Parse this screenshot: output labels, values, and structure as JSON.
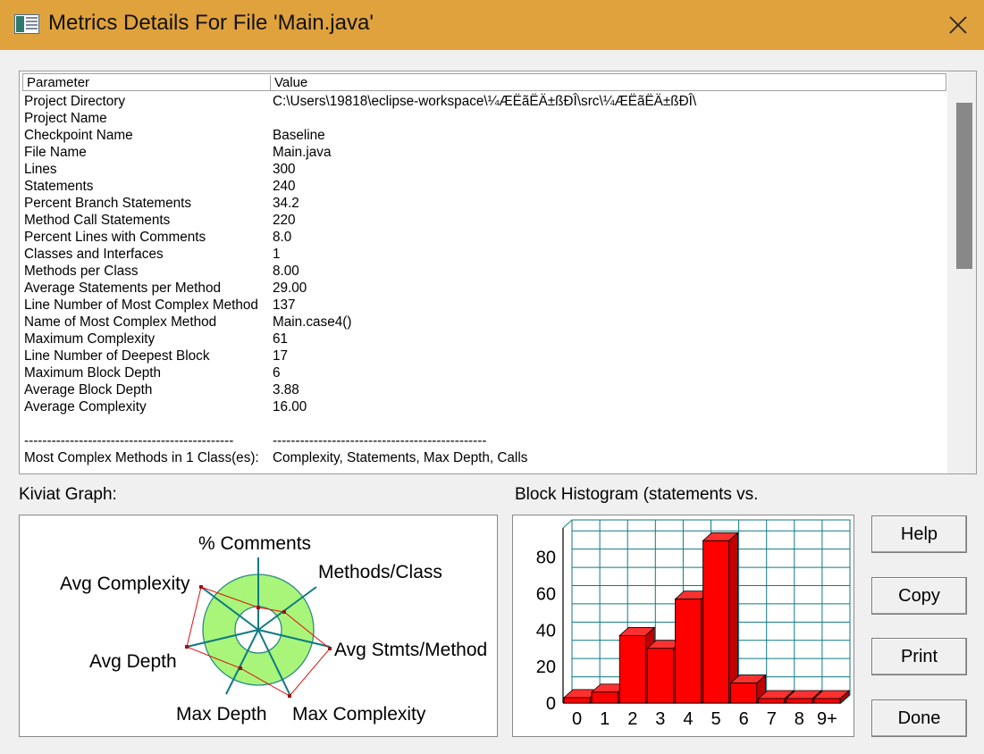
{
  "window": {
    "title": "Metrics Details For File 'Main.java'",
    "accent_color": "#e0a23c"
  },
  "table": {
    "headers": {
      "parameter": "Parameter",
      "value": "Value"
    },
    "rows": [
      {
        "p": "Project Directory",
        "v": "C:\\Users\\19818\\eclipse-workspace\\¼ÆËãËÄ±ßÐÎ\\src\\¼ÆËãËÄ±ßÐÎ\\"
      },
      {
        "p": "Project Name",
        "v": ""
      },
      {
        "p": "Checkpoint Name",
        "v": "Baseline"
      },
      {
        "p": "File Name",
        "v": "Main.java"
      },
      {
        "p": "Lines",
        "v": "300"
      },
      {
        "p": "Statements",
        "v": "240"
      },
      {
        "p": "Percent Branch Statements",
        "v": "34.2"
      },
      {
        "p": "Method Call Statements",
        "v": "220"
      },
      {
        "p": "Percent Lines with Comments",
        "v": "8.0"
      },
      {
        "p": "Classes and Interfaces",
        "v": "1"
      },
      {
        "p": "Methods per Class",
        "v": "8.00"
      },
      {
        "p": "Average Statements per Method",
        "v": "29.00"
      },
      {
        "p": "Line Number of Most Complex Method",
        "v": "137"
      },
      {
        "p": "Name of Most Complex Method",
        "v": "Main.case4()"
      },
      {
        "p": "Maximum Complexity",
        "v": "61"
      },
      {
        "p": "Line Number of Deepest Block",
        "v": "17"
      },
      {
        "p": "Maximum Block Depth",
        "v": "6"
      },
      {
        "p": "Average Block Depth",
        "v": "3.88"
      },
      {
        "p": "Average Complexity",
        "v": "16.00"
      },
      {
        "p": "",
        "v": ""
      },
      {
        "p": "----------------------------------------------",
        "v": "-----------------------------------------------"
      },
      {
        "p": "Most Complex Methods in 1 Class(es):",
        "v": "Complexity, Statements, Max Depth, Calls"
      }
    ]
  },
  "kiviat": {
    "label": "Kiviat Graph:",
    "axes": [
      "% Comments",
      "Methods/Class",
      "Avg Stmts/Method",
      "Max Complexity",
      "Max Depth",
      "Avg Depth",
      "Avg Complexity"
    ]
  },
  "histogram": {
    "label": "Block Histogram (statements vs."
  },
  "buttons": {
    "help": "Help",
    "copy": "Copy",
    "print": "Print",
    "done": "Done"
  },
  "chart_data": {
    "type": "bar",
    "title": "Block Histogram (statements vs.",
    "categories": [
      "0",
      "1",
      "2",
      "3",
      "4",
      "5",
      "6",
      "7",
      "8",
      "9+"
    ],
    "values": [
      3,
      6,
      37,
      30,
      57,
      89,
      11,
      0,
      0,
      0
    ],
    "ylim": [
      0,
      90
    ],
    "yticks": [
      "0",
      "20",
      "40",
      "60",
      "80"
    ],
    "grid": true,
    "bar_color": "#ff0000"
  }
}
